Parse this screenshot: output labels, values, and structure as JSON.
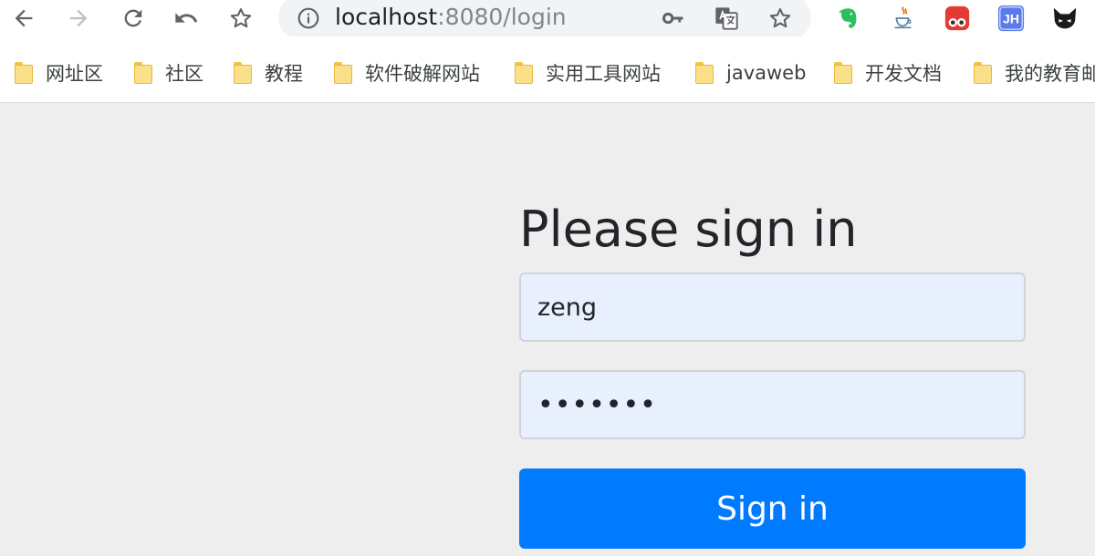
{
  "browser": {
    "url_host": "localhost",
    "url_rest": ":8080/login"
  },
  "bookmarks": [
    {
      "label": "网址区"
    },
    {
      "label": "社区"
    },
    {
      "label": "教程"
    },
    {
      "label": "软件破解网站"
    },
    {
      "label": "实用工具网站"
    },
    {
      "label": "javaweb"
    },
    {
      "label": "开发文档"
    },
    {
      "label": "我的教育邮"
    }
  ],
  "extensions": {
    "jh_label": "JH"
  },
  "page": {
    "heading": "Please sign in",
    "username_value": "zeng",
    "password_value": "•••••••",
    "signin_label": "Sign in"
  },
  "colors": {
    "primary": "#007bff",
    "input_bg": "#e8f0fe",
    "page_bg": "#eeeeee"
  }
}
